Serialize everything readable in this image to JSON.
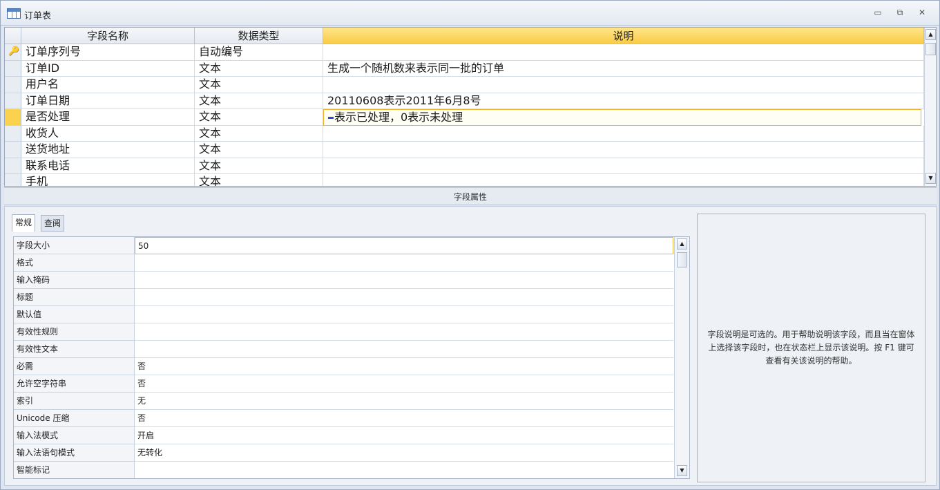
{
  "window": {
    "title": "订单表"
  },
  "grid": {
    "headers": {
      "field_name": "字段名称",
      "data_type": "数据类型",
      "description": "说明"
    },
    "rows": [
      {
        "field": "订单序列号",
        "type": "自动编号",
        "desc": "",
        "primary_key": true
      },
      {
        "field": "订单ID",
        "type": "文本",
        "desc": "生成一个随机数来表示同一批的订单"
      },
      {
        "field": "用户名",
        "type": "文本",
        "desc": ""
      },
      {
        "field": "订单日期",
        "type": "文本",
        "desc": "20110608表示2011年6月8号"
      },
      {
        "field": "是否处理",
        "type": "文本",
        "desc": "表示已处理，0表示未处理",
        "current": true
      },
      {
        "field": "收货人",
        "type": "文本",
        "desc": ""
      },
      {
        "field": "送货地址",
        "type": "文本",
        "desc": ""
      },
      {
        "field": "联系电话",
        "type": "文本",
        "desc": ""
      },
      {
        "field": "手机",
        "type": "文本",
        "desc": ""
      }
    ]
  },
  "properties": {
    "strip_label": "字段属性",
    "tabs": [
      "常规",
      "查阅"
    ],
    "rows": [
      {
        "label": "字段大小",
        "value": "50"
      },
      {
        "label": "格式",
        "value": ""
      },
      {
        "label": "输入掩码",
        "value": ""
      },
      {
        "label": "标题",
        "value": ""
      },
      {
        "label": "默认值",
        "value": ""
      },
      {
        "label": "有效性规则",
        "value": ""
      },
      {
        "label": "有效性文本",
        "value": ""
      },
      {
        "label": "必需",
        "value": "否"
      },
      {
        "label": "允许空字符串",
        "value": "否"
      },
      {
        "label": "索引",
        "value": "无"
      },
      {
        "label": "Unicode 压缩",
        "value": "否"
      },
      {
        "label": "输入法模式",
        "value": "开启"
      },
      {
        "label": "输入法语句模式",
        "value": "无转化"
      },
      {
        "label": "智能标记",
        "value": ""
      }
    ],
    "help_text": "字段说明是可选的。用于帮助说明该字段，而且当在窗体上选择该字段时，也在状态栏上显示该说明。按 F1 键可查看有关该说明的帮助。"
  },
  "colors": {
    "active_header": "#f9cc45",
    "selected_row_marker": "#fbd24e",
    "window_background": "#dfe6f0"
  }
}
